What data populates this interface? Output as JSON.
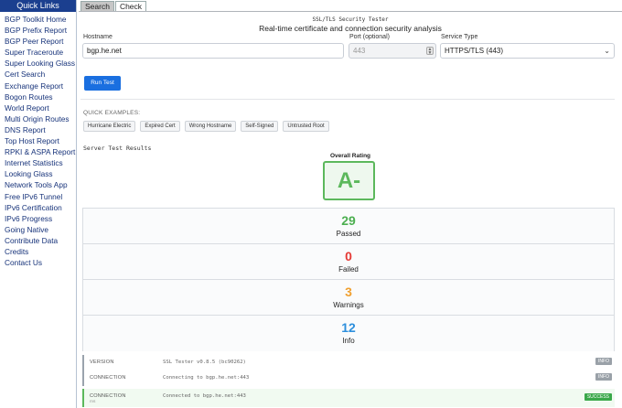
{
  "sidebar": {
    "title": "Quick Links",
    "items": [
      "BGP Toolkit Home",
      "BGP Prefix Report",
      "BGP Peer Report",
      "Super Traceroute",
      "Super Looking Glass",
      "Cert Search",
      "Exchange Report",
      "Bogon Routes",
      "World Report",
      "Multi Origin Routes",
      "DNS Report",
      "Top Host Report",
      "RPKI & ASPA Report",
      "Internet Statistics",
      "Looking Glass",
      "Network Tools App",
      "Free IPv6 Tunnel",
      "IPv6 Certification",
      "IPv6 Progress",
      "Going Native",
      "Contribute Data",
      "Credits",
      "Contact Us"
    ]
  },
  "tabs": [
    "Search",
    "Check"
  ],
  "app": {
    "title": "SSL/TLS Security Tester",
    "subtitle": "Real-time certificate and connection security analysis"
  },
  "form": {
    "hostname_label": "Hostname",
    "hostname_value": "bgp.he.net",
    "port_label": "Port (optional)",
    "port_placeholder": "443",
    "service_label": "Service Type",
    "service_value": "HTTPS/TLS (443)",
    "run_label": "Run Test"
  },
  "quick_examples": {
    "title": "QUICK EXAMPLES:",
    "items": [
      "Hurricane Electric",
      "Expired Cert",
      "Wrong Hostname",
      "Self-Signed",
      "Untrusted Root"
    ]
  },
  "results": {
    "title": "Server Test Results",
    "overall_label": "Overall Rating",
    "grade": "A-",
    "stats": [
      {
        "value": "29",
        "label": "Passed",
        "color": "#4caf50"
      },
      {
        "value": "0",
        "label": "Failed",
        "color": "#e53935"
      },
      {
        "value": "3",
        "label": "Warnings",
        "color": "#f0a030"
      },
      {
        "value": "12",
        "label": "Info",
        "color": "#2d8fdd"
      }
    ],
    "log": [
      {
        "key": "VERSION",
        "sub": "",
        "value": "SSL Tester v0.8.5 (bc90262)",
        "tag": "INFO"
      },
      {
        "key": "CONNECTION",
        "sub": "",
        "value": "Connecting to bgp.he.net:443",
        "tag": "INFO"
      },
      {
        "key": "CONNECTION",
        "sub": "ms",
        "value": "Connected to bgp.he.net:443",
        "tag": "SUCCESS"
      }
    ]
  }
}
